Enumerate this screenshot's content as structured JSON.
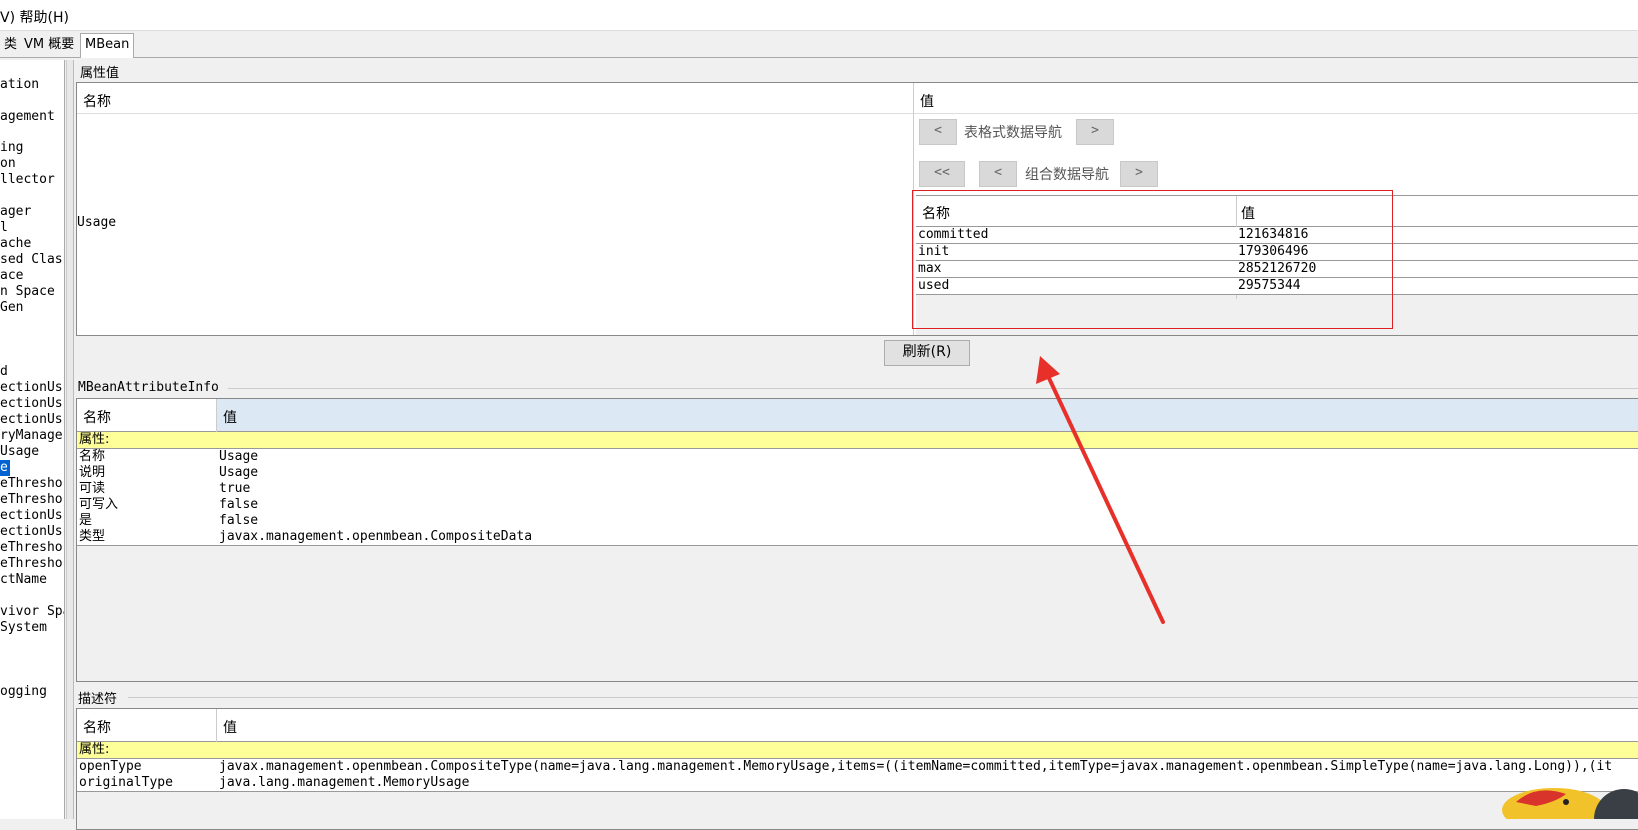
{
  "menubar": {
    "items": [
      "V) 帮助(H)"
    ]
  },
  "tabs": [
    "类",
    "VM 概要",
    "MBean"
  ],
  "tree": {
    "items": [
      "ation",
      "agement",
      "ing",
      "on",
      "llector",
      "ager",
      "l",
      "ache",
      "sed Clas",
      "ace",
      "n Space",
      " Gen",
      "d",
      "ectionUs",
      "ectionUs",
      "ectionUs",
      "ryManage:",
      "Usage",
      "e",
      "eThresho",
      "eThresho",
      "ectionUs",
      "ectionUs",
      "eThresho",
      "eThresho",
      "ctName",
      "vivor Spa",
      " System",
      "ogging"
    ],
    "selected_label": "e"
  },
  "attr_section": {
    "title": "属性值",
    "col_name": "名称",
    "col_value": "值",
    "row_name": "Usage",
    "table_nav_label": "表格式数据导航",
    "composite_nav_label": "组合数据导航",
    "btn_prev": "<",
    "btn_next": ">",
    "btn_first": "<<",
    "composite": {
      "col_name": "名称",
      "col_value": "值",
      "rows": [
        {
          "name": "committed",
          "value": "121634816"
        },
        {
          "name": "init",
          "value": "179306496"
        },
        {
          "name": "max",
          "value": "2852126720"
        },
        {
          "name": "used",
          "value": "29575344"
        }
      ]
    }
  },
  "refresh_label": "刷新(R)",
  "info_section": {
    "title": "MBeanAttributeInfo",
    "col_name": "名称",
    "col_value": "值",
    "group_label": "属性:",
    "rows": [
      {
        "name": "名称",
        "value": "Usage"
      },
      {
        "name": "说明",
        "value": "Usage"
      },
      {
        "name": "可读",
        "value": "true"
      },
      {
        "name": "可写入",
        "value": "false"
      },
      {
        "name": "是",
        "value": "false"
      },
      {
        "name": "类型",
        "value": "javax.management.openmbean.CompositeData"
      }
    ]
  },
  "desc_section": {
    "title": "描述符",
    "col_name": "名称",
    "col_value": "值",
    "group_label": "属性:",
    "rows": [
      {
        "name": "openType",
        "value": "javax.management.openmbean.CompositeType(name=java.lang.management.MemoryUsage,items=((itemName=committed,itemType=javax.management.openmbean.SimpleType(name=java.lang.Long)),(it"
      },
      {
        "name": "originalType",
        "value": "java.lang.management.MemoryUsage"
      }
    ]
  },
  "colors": {
    "highlight_box": "#e02020",
    "arrow": "#e8302a",
    "selection": "#0063d1",
    "group_row": "#ffff99"
  }
}
